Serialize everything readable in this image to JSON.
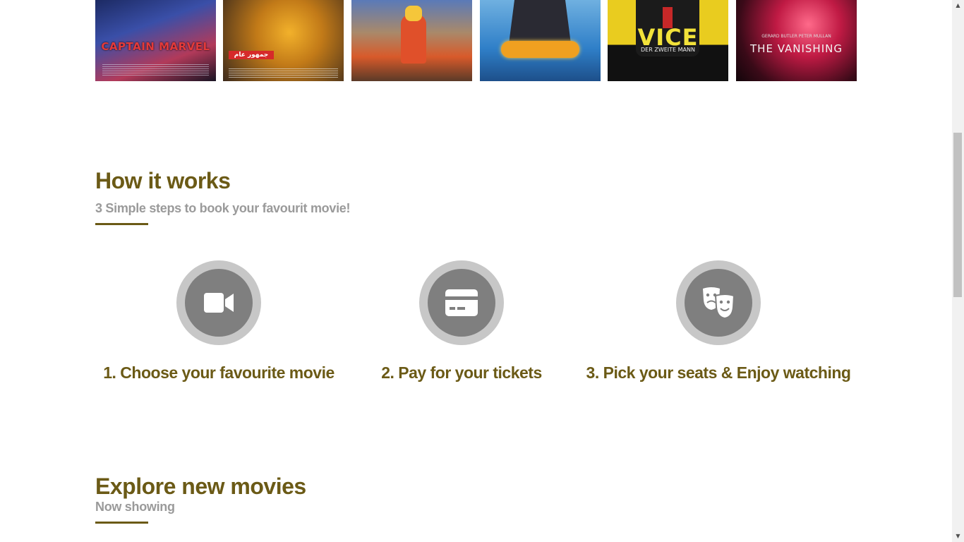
{
  "posters": [
    {
      "title": "CAPTAIN MARVEL"
    },
    {
      "title": "جمهور عام"
    },
    {
      "title": ""
    },
    {
      "title": ""
    },
    {
      "title": "VICE",
      "subtitle": "DER ZWEITE MANN"
    },
    {
      "title": "THE VANISHING",
      "names": "GERARD BUTLER     PETER MULLAN"
    }
  ],
  "how_it_works": {
    "title": "How it works",
    "subtitle": "3 Simple steps to book your favourit movie!",
    "steps": [
      {
        "label": "1. Choose your favourite movie",
        "icon": "video-camera-icon"
      },
      {
        "label": "2. Pay for your tickets",
        "icon": "credit-card-icon"
      },
      {
        "label": "3. Pick your seats & Enjoy watching",
        "icon": "theater-masks-icon"
      }
    ]
  },
  "explore": {
    "title": "Explore new movies",
    "subtitle": "Now showing"
  },
  "colors": {
    "accent": "#6b5a16",
    "muted_text": "#9a9a9a",
    "icon_ring": "#c7c7c7",
    "icon_disc": "#7f7f7f"
  }
}
